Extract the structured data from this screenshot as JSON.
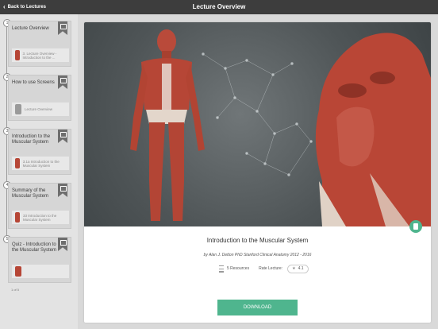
{
  "header": {
    "back_label": "Back to Lectures",
    "title": "Lecture Overview"
  },
  "sidebar": {
    "lessons": [
      {
        "number": "1",
        "title": "Lecture Overview",
        "sub": "3. Lecture Overview - Introduction to the ..."
      },
      {
        "number": "2",
        "title": "How to use Screens",
        "sub": "Lecture Overview"
      },
      {
        "number": "3",
        "title": "Introduction to the Muscular System",
        "sub": "3.1a Introduction to the Muscular System"
      },
      {
        "number": "4",
        "title": "Summary of the Muscular System",
        "sub": "33 Introduction to the Muscular System"
      },
      {
        "number": "5",
        "title": "Quiz - Introduction to the Muscular System",
        "sub": ""
      }
    ],
    "page_indicator": "1 of 5"
  },
  "main": {
    "title": "Introduction to the Muscular System",
    "author": "by Alan J. Detton PhD Stanford Clinical Anatomy 2012 - 2016",
    "resources": "5 Resources",
    "rate_label": "Rate Lecture:",
    "rating": "4.1",
    "download_label": "DOWNLOAD"
  },
  "colors": {
    "accent": "#4fb58e",
    "header_bg": "#3d3d3d",
    "muscle": "#b64636"
  }
}
